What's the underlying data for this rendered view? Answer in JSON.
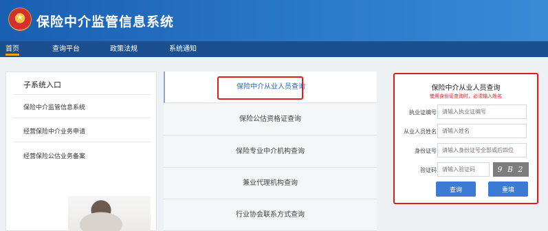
{
  "header": {
    "title": "保险中介监管信息系统",
    "emblem_icon": "national-emblem-icon"
  },
  "nav": {
    "items": [
      "首页",
      "查询平台",
      "政策法规",
      "系统通知"
    ],
    "active_index": 0
  },
  "sidebar": {
    "title": "子系统入口",
    "items": [
      "保险中介监管信息系统",
      "经营保险中介业务申请",
      "经营保险公估业务备案"
    ]
  },
  "tabs": [
    "保险中介从业人员查询",
    "保险公估资格证查询",
    "保险专业中介机构查询",
    "兼业代理机构查询",
    "行业协会联系方式查询"
  ],
  "form": {
    "title": "保险中介从业人员查询",
    "hint": "使用身份证查询时，必须输入姓名",
    "fields": [
      {
        "label": "执业证编号",
        "placeholder": "请输入执业证编号"
      },
      {
        "label": "从业人员姓名",
        "placeholder": "请输入姓名"
      },
      {
        "label": "身份证号",
        "placeholder": "请输入身份证号全部或后四位"
      },
      {
        "label": "验证码",
        "placeholder": "请输入验证码"
      }
    ],
    "captcha": "9 B 2 A",
    "query_button": "查询",
    "reset_button": "重填"
  },
  "colors": {
    "header": "#2a78c8",
    "nav": "#1b4f8e",
    "highlight": "#e01b1b",
    "button": "#3c7bd4",
    "nav_active": "#f0a500"
  }
}
